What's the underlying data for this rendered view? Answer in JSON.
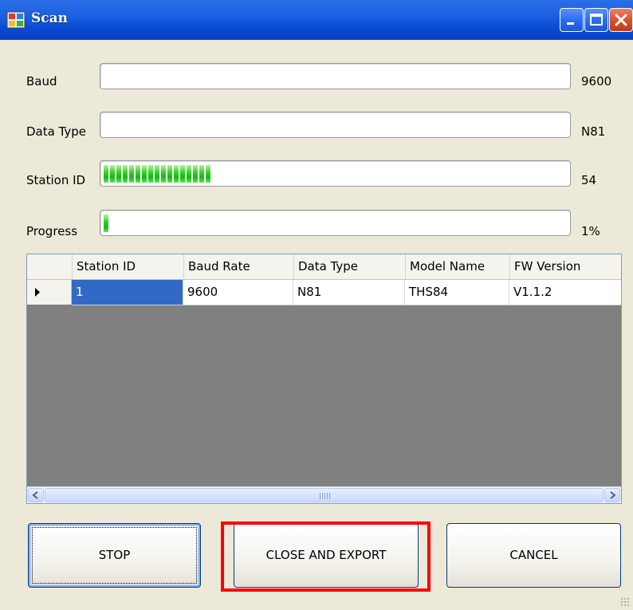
{
  "window": {
    "title": "Scan",
    "controls": [
      "minimize-icon",
      "maximize-icon",
      "close-icon"
    ]
  },
  "fields": [
    {
      "label": "Baud",
      "value": "9600",
      "progress_fraction": 0.0
    },
    {
      "label": "Data Type",
      "value": "N81",
      "progress_fraction": 0.0
    },
    {
      "label": "Station ID",
      "value": "54",
      "progress_fraction": 0.23
    },
    {
      "label": "Progress",
      "value": "1%",
      "progress_fraction": 0.01
    }
  ],
  "grid": {
    "columns": [
      "Station ID",
      "Baud Rate",
      "Data Type",
      "Model Name",
      "FW Version"
    ],
    "rows": [
      {
        "cells": [
          "1",
          "9600",
          "N81",
          "THS84",
          "V1.1.2"
        ],
        "selected_cell": 0,
        "current": true
      }
    ]
  },
  "buttons": {
    "stop": "STOP",
    "close_export": "CLOSE AND EXPORT",
    "cancel": "CANCEL"
  },
  "colors": {
    "titlebar": "#0a4bd4",
    "progress": "#14b812",
    "selection": "#316ac5",
    "highlight": "#ff0000"
  }
}
